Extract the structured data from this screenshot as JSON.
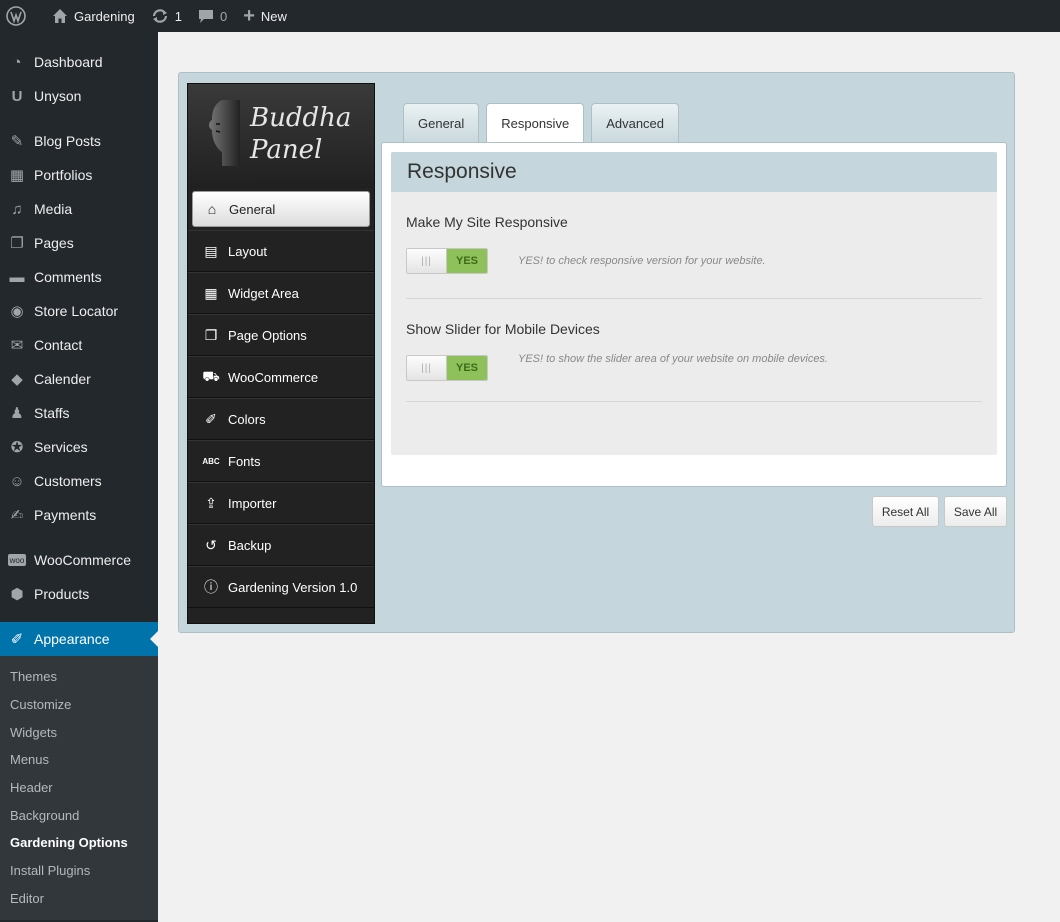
{
  "adminbar": {
    "site_name": "Gardening",
    "updates_count": "1",
    "comments_count": "0",
    "new_label": "New"
  },
  "sidebar": {
    "items": [
      {
        "label": "Dashboard",
        "icon": "dashboard-icon"
      },
      {
        "label": "Unyson",
        "icon": "unyson-icon"
      },
      {
        "label": "Blog Posts",
        "icon": "pin-icon"
      },
      {
        "label": "Portfolios",
        "icon": "portfolio-icon"
      },
      {
        "label": "Media",
        "icon": "media-icon"
      },
      {
        "label": "Pages",
        "icon": "pages-icon"
      },
      {
        "label": "Comments",
        "icon": "comments-icon"
      },
      {
        "label": "Store Locator",
        "icon": "location-icon"
      },
      {
        "label": "Contact",
        "icon": "mail-icon"
      },
      {
        "label": "Calender",
        "icon": "calendar-icon"
      },
      {
        "label": "Staffs",
        "icon": "staff-icon"
      },
      {
        "label": "Services",
        "icon": "services-icon"
      },
      {
        "label": "Customers",
        "icon": "customers-icon"
      },
      {
        "label": "Payments",
        "icon": "payments-icon"
      },
      {
        "label": "WooCommerce",
        "icon": "woocommerce-icon"
      },
      {
        "label": "Products",
        "icon": "products-icon"
      },
      {
        "label": "Appearance",
        "icon": "brush-icon"
      }
    ],
    "submenu": [
      "Themes",
      "Customize",
      "Widgets",
      "Menus",
      "Header",
      "Background",
      "Gardening Options",
      "Install Plugins",
      "Editor"
    ]
  },
  "panel": {
    "logo_line1": "Buddha",
    "logo_line2": "Panel",
    "nav": [
      {
        "label": "General",
        "icon": "home-icon"
      },
      {
        "label": "Layout",
        "icon": "layout-icon"
      },
      {
        "label": "Widget Area",
        "icon": "widget-area-icon"
      },
      {
        "label": "Page Options",
        "icon": "copy-icon"
      },
      {
        "label": "WooCommerce",
        "icon": "cart-icon"
      },
      {
        "label": "Colors",
        "icon": "brush-icon"
      },
      {
        "label": "Fonts",
        "icon": "fonts-icon"
      },
      {
        "label": "Importer",
        "icon": "upload-icon"
      },
      {
        "label": "Backup",
        "icon": "history-icon"
      },
      {
        "label": "Gardening Version 1.0",
        "icon": "info-icon"
      }
    ],
    "tabs": [
      "General",
      "Responsive",
      "Advanced"
    ],
    "section_title": "Responsive",
    "options": [
      {
        "title": "Make My Site Responsive",
        "toggle": "YES",
        "knob": "|||",
        "desc": "YES! to check responsive version for your website."
      },
      {
        "title": "Show Slider for Mobile Devices",
        "toggle": "YES",
        "knob": "|||",
        "desc": "YES! to show the slider area of your website on mobile devices."
      }
    ],
    "reset_label": "Reset All",
    "save_label": "Save All"
  }
}
